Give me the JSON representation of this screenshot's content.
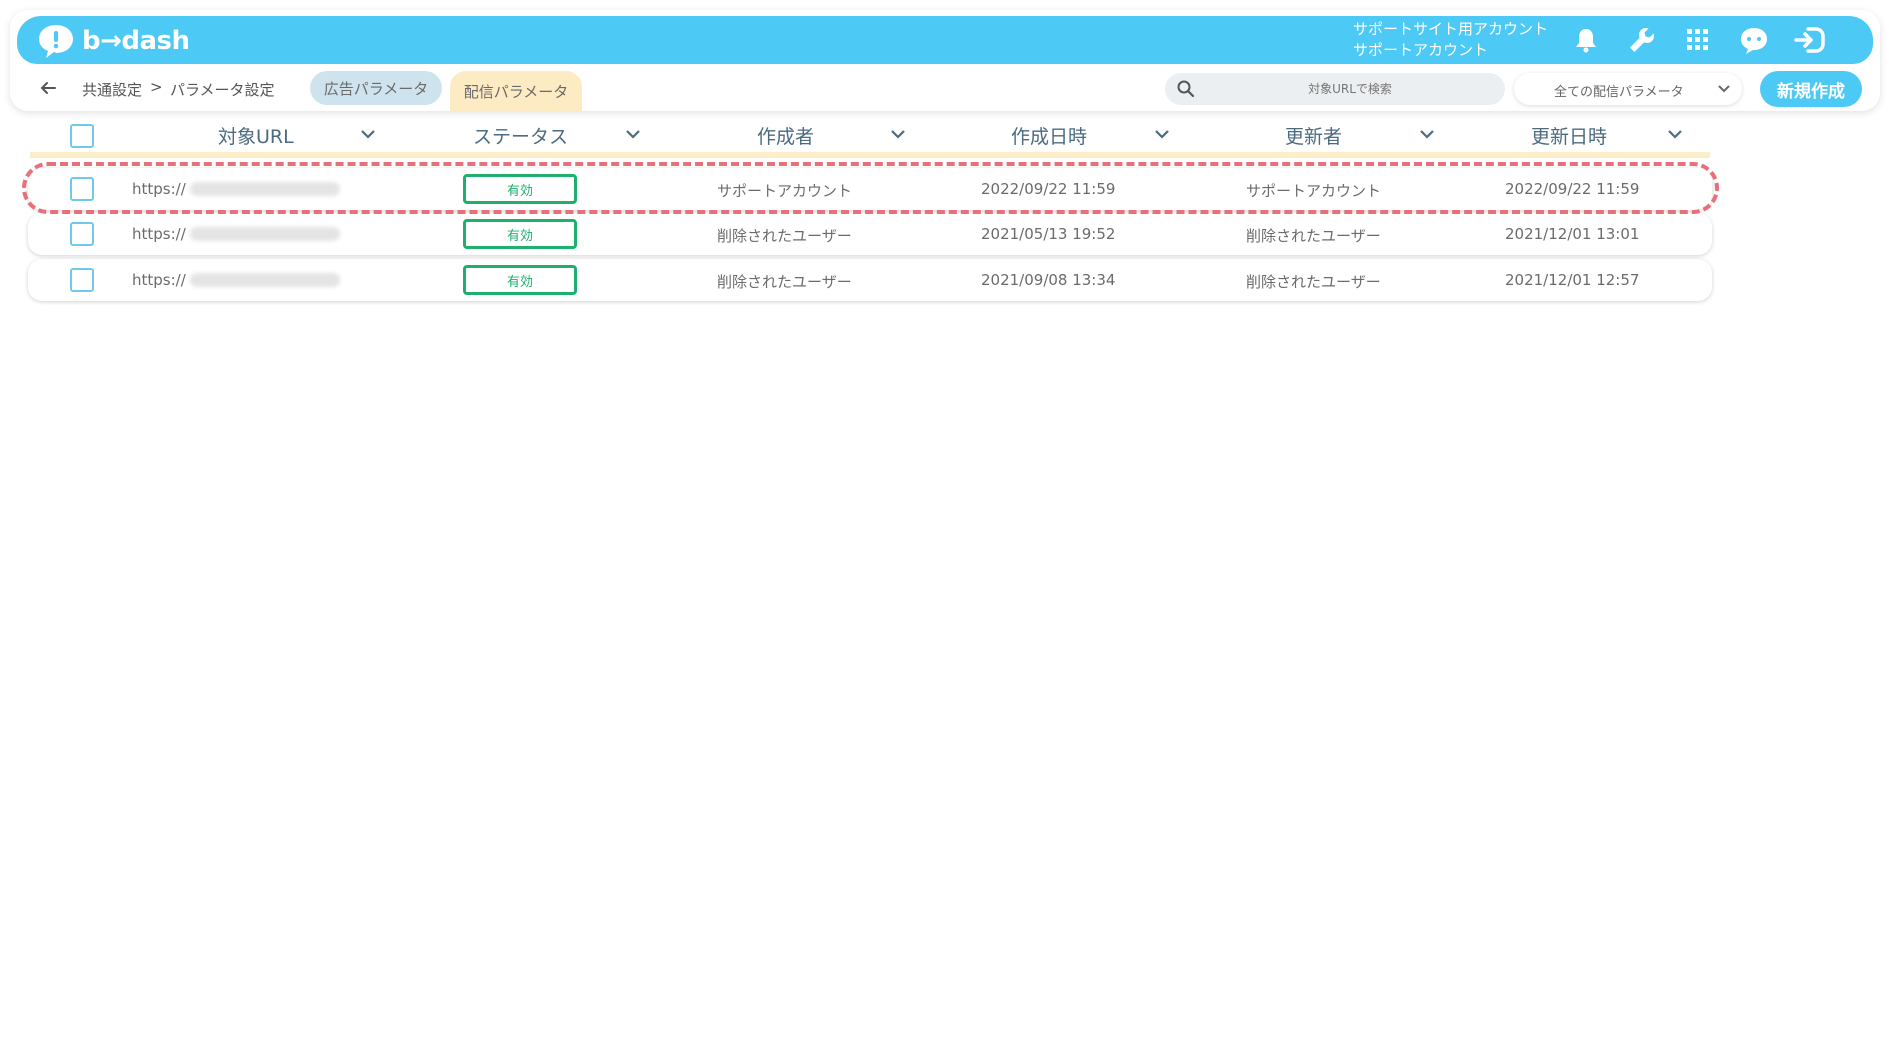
{
  "app": {
    "logo_text": "b→dash"
  },
  "account": {
    "line1": "サポートサイト用アカウント",
    "line2": "サポートアカウント"
  },
  "header_icons": [
    "bell-icon",
    "wrench-icon",
    "grid-icon",
    "bot-icon",
    "logout-icon"
  ],
  "breadcrumb": {
    "parent": "共通設定",
    "separator": ">",
    "current": "パラメータ設定"
  },
  "tabs": [
    {
      "label": "広告パラメータ",
      "active": false
    },
    {
      "label": "配信パラメータ",
      "active": true
    }
  ],
  "search": {
    "placeholder": "対象URLで検索"
  },
  "filter": {
    "selected": "全ての配信パラメータ"
  },
  "create_label": "新規作成",
  "table": {
    "headers": [
      "対象URL",
      "ステータス",
      "作成者",
      "作成日時",
      "更新者",
      "更新日時"
    ],
    "rows": [
      {
        "url": "https://",
        "status": "有効",
        "creator": "サポートアカウント",
        "created": "2022/09/22 11:59",
        "updater": "サポートアカウント",
        "updated": "2022/09/22 11:59"
      },
      {
        "url": "https://",
        "status": "有効",
        "creator": "削除されたユーザー",
        "created": "2021/05/13 19:52",
        "updater": "削除されたユーザー",
        "updated": "2021/12/01 13:01"
      },
      {
        "url": "https://",
        "status": "有効",
        "creator": "削除されたユーザー",
        "created": "2021/09/08 13:34",
        "updater": "削除されたユーザー",
        "updated": "2021/12/01 12:57"
      }
    ]
  },
  "colors": {
    "brand": "#4dc9f5",
    "status_active": "#1fb06e",
    "highlight": "#e8707a",
    "active_tab": "#fdebc4"
  }
}
